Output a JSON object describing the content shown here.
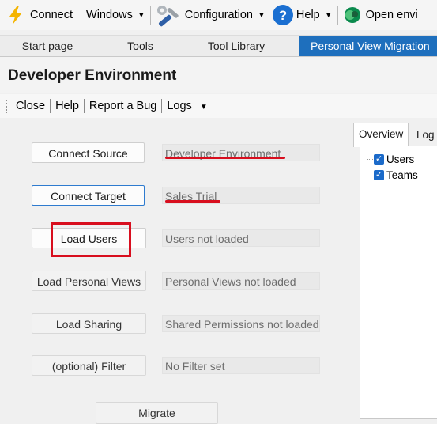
{
  "toolbar": {
    "connect": "Connect",
    "windows": "Windows",
    "configuration": "Configuration",
    "help": "Help",
    "open_env": "Open envi"
  },
  "tabs": [
    "Start page",
    "Tools",
    "Tool Library",
    "Personal View Migration"
  ],
  "active_tab": "Personal View Migration",
  "header": {
    "title": "Developer Environment"
  },
  "commands": {
    "close": "Close",
    "help": "Help",
    "report_bug": "Report a Bug",
    "logs": "Logs"
  },
  "actions": [
    {
      "button": "Connect Source",
      "status": "Developer Environment"
    },
    {
      "button": "Connect Target",
      "status": "Sales Trial"
    },
    {
      "button": "Load Users",
      "status": "Users not loaded"
    },
    {
      "button": "Load Personal Views",
      "status": "Personal Views not loaded"
    },
    {
      "button": "Load Sharing",
      "status": "Shared Permissions not loaded"
    },
    {
      "button": "(optional) Filter",
      "status": "No Filter set"
    }
  ],
  "migrate_button": "Migrate",
  "right_panel": {
    "tabs": [
      "Overview",
      "Log"
    ],
    "tree": [
      "Users",
      "Teams"
    ]
  },
  "colors": {
    "accent": "#1e6fbd",
    "annotation_red": "#d80e1e",
    "checkbox": "#1b6ac9"
  }
}
